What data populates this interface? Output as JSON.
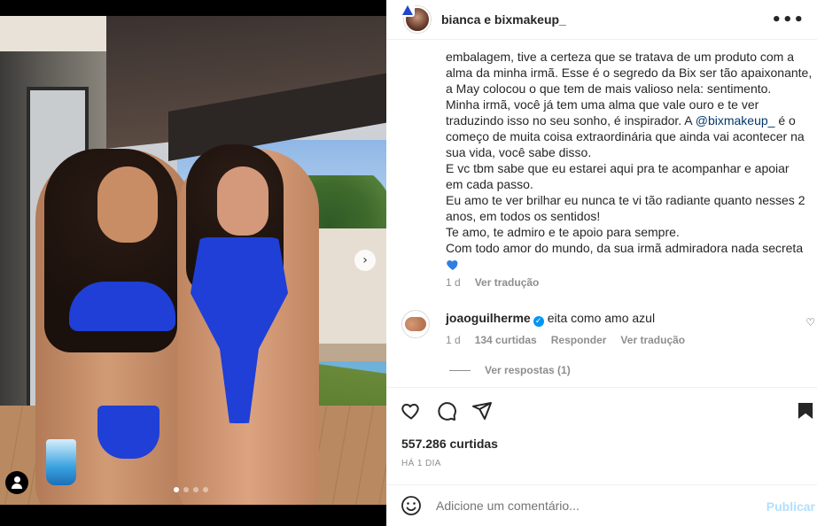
{
  "post": {
    "username": "bianca e bixmakeup_",
    "caption_lines": [
      "embalagem, tive a certeza que se tratava de um produto com a",
      "alma da minha irmã. Esse é o segredo da Bix ser tão apaixonante,",
      "a May colocou o que tem de mais valioso nela: sentimento.",
      "Minha irmã, você já tem uma alma que vale ouro e te ver",
      "traduzindo isso no seu sonho, é inspirador. A ",
      "começo de muita coisa extraordinária que ainda vai acontecer na",
      "sua vida, você sabe disso.",
      "E vc tbm sabe que eu estarei aqui pra te acompanhar e apoiar",
      "em cada passo.",
      "Eu amo te ver brilhar eu nunca te vi tão radiante quanto nesses 2",
      "anos, em todos os sentidos!",
      "Te amo, te admiro e te apoio para sempre.",
      "Com todo amor do mundo, da sua irmã admiradora nada secreta"
    ],
    "mention": "@bixmakeup_",
    "mention_suffix": " é o",
    "caption_time": "1 d",
    "caption_translate": "Ver tradução",
    "likes": "557.286 curtidas",
    "posted_ago": "HÁ 1 DIA",
    "carousel_total": 4,
    "carousel_active": 0
  },
  "comment": {
    "username": "joaoguilherme",
    "text": "eita como amo azul",
    "time": "1 d",
    "likes": "134 curtidas",
    "reply": "Responder",
    "translate": "Ver tradução",
    "view_replies": "Ver respostas (1)"
  },
  "composer": {
    "placeholder": "Adicione um comentário...",
    "publish": "Publicar"
  },
  "icons": {
    "more": "more-options-icon",
    "like": "heart-icon",
    "comment": "comment-icon",
    "share": "share-icon",
    "save": "bookmark-icon",
    "emoji": "emoji-icon",
    "next": "chevron-right-icon",
    "tags": "user-tag-icon"
  },
  "colors": {
    "link": "#00376b",
    "muted": "#8e8e8e",
    "publish_disabled": "#b2dffc",
    "verified": "#0095f6",
    "heart_emoji": "#2f7fe0"
  }
}
